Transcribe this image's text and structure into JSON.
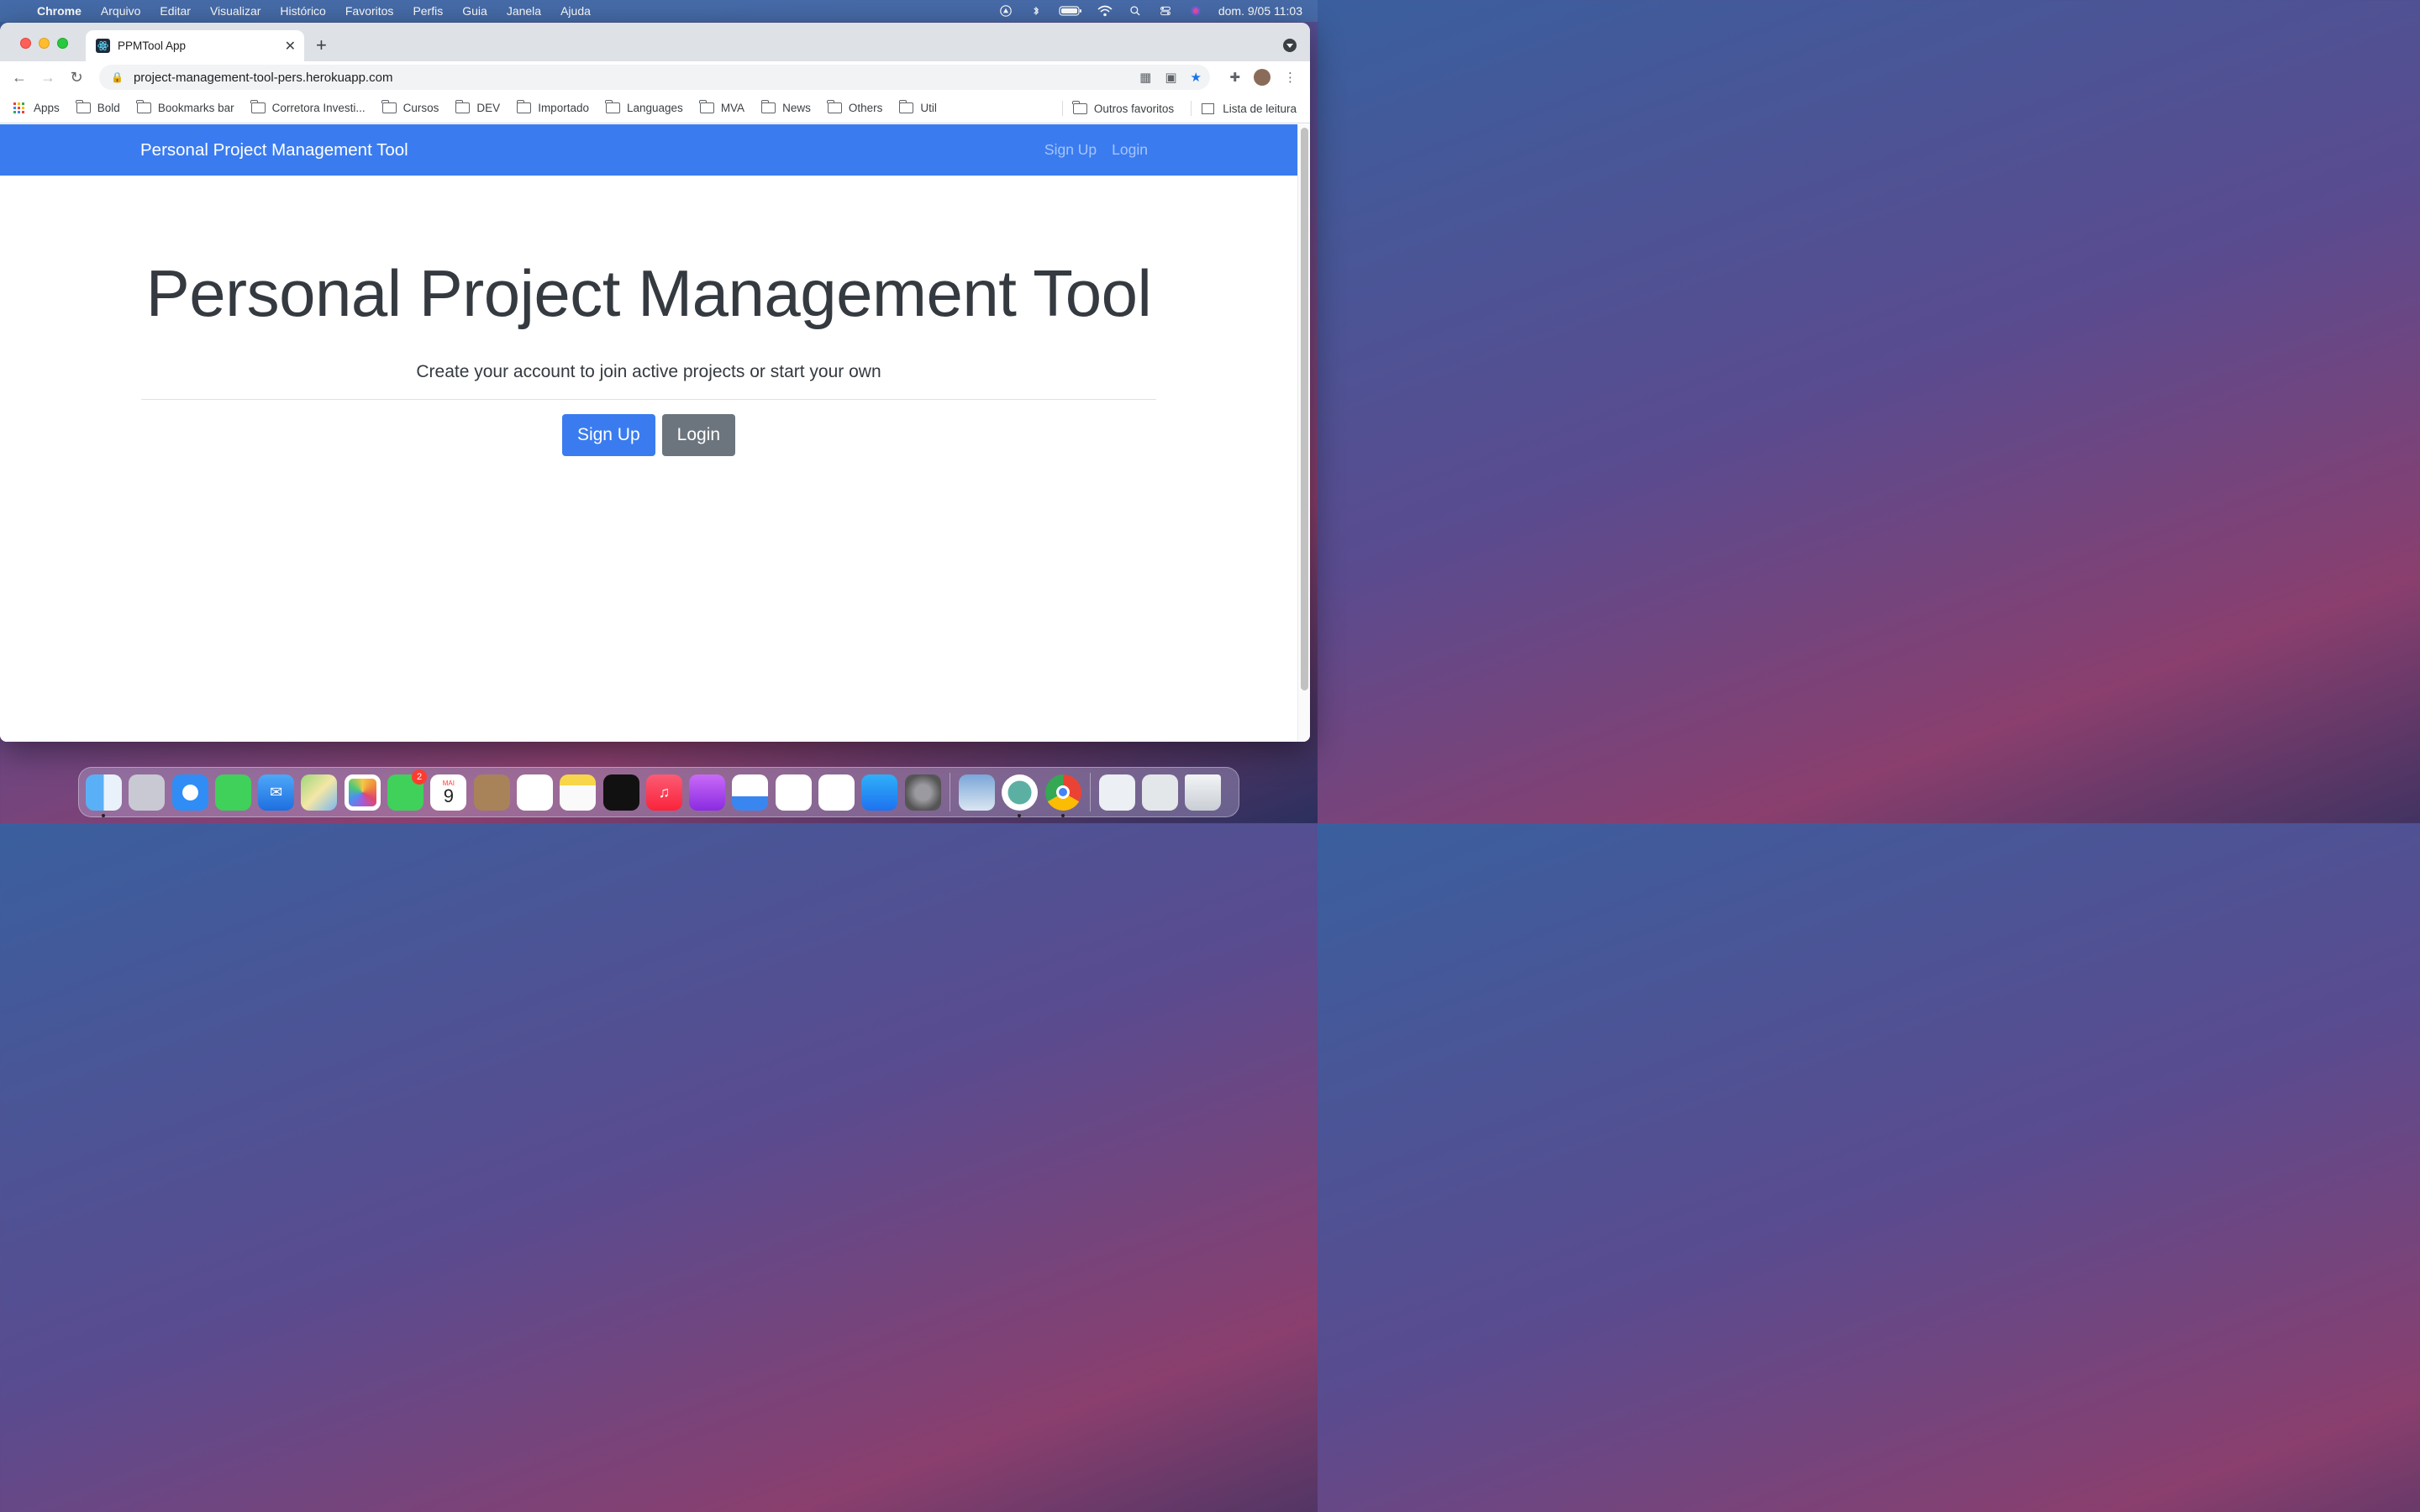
{
  "menubar": {
    "app_name": "Chrome",
    "menus": [
      "Arquivo",
      "Editar",
      "Visualizar",
      "Histórico",
      "Favoritos",
      "Perfis",
      "Guia",
      "Janela",
      "Ajuda"
    ],
    "clock": "dom. 9/05  11:03"
  },
  "tab": {
    "title": "PPMTool App"
  },
  "address_bar": {
    "url": "project-management-tool-pers.herokuapp.com"
  },
  "bookmarks": {
    "apps_label": "Apps",
    "folders": [
      "Bold",
      "Bookmarks bar",
      "Corretora Investi...",
      "Cursos",
      "DEV",
      "Importado",
      "Languages",
      "MVA",
      "News",
      "Others",
      "Util"
    ],
    "other_bookmarks": "Outros favoritos",
    "reading_list": "Lista de leitura"
  },
  "site": {
    "navbar": {
      "brand": "Personal Project Management Tool",
      "signup_link": "Sign Up",
      "login_link": "Login"
    },
    "landing": {
      "heading": "Personal Project Management Tool",
      "lead": "Create your account to join active projects or start your own",
      "signup_button": "Sign Up",
      "login_button": "Login"
    },
    "colors": {
      "primary": "#3a7cf0",
      "secondary": "#6c757d",
      "text": "#343a40"
    }
  },
  "dock": {
    "facetime_badge": "2",
    "calendar_month": "MAI",
    "calendar_day": "9",
    "apps": [
      "finder-icon",
      "launchpad-icon",
      "safari-icon",
      "messages-icon",
      "mail-icon",
      "maps-icon",
      "photos-icon",
      "facetime-icon",
      "calendar-icon",
      "contacts-icon",
      "reminders-icon",
      "notes-icon",
      "appletv-icon",
      "music-icon",
      "podcasts-icon",
      "keynote-icon",
      "numbers-icon",
      "pages-icon",
      "appstore-icon",
      "system-preferences-icon",
      "preview-icon",
      "vpn-icon",
      "chrome-icon",
      "documents-stack-icon",
      "downloads-stack-icon",
      "trash-icon"
    ]
  }
}
